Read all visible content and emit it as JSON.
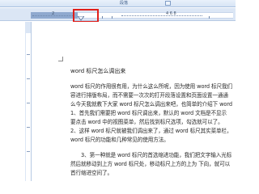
{
  "ribbon": {
    "group_label": "段落"
  },
  "ruler": {
    "left_number": "2",
    "right_number": "4 6 8"
  },
  "document": {
    "title": "word 标尺怎么调出来",
    "lines": [
      "word 标尺的作用很有用，为什么这么所呢，因为使用 word 标尺我们",
      "容进行排版布局，而不需要一次次的打开段落设置和页面设置一通通",
      "么今天我就教下大家 word 标尺怎么调出来吧，也简单的介绍下 word",
      "1、首先我们需要把 word 标尺调出来，默认的 word 文档是不显示",
      "要点击 word 中的视图菜单，然后找到标尺选项，勾选就可以了。",
      "2、这样 word 标尺就被我们调出来了，通过 word 标尺其实菜单栏，",
      "word 标尺的功能和几种常见的使用方法。",
      "3、第一种就是 word 标尺的首选缩进功能，我们把文字输入光标",
      "然后就移动到上方 word 标尺处，移动标尺上方的上为 下向，就可以",
      "首行缩进空间了。"
    ]
  }
}
